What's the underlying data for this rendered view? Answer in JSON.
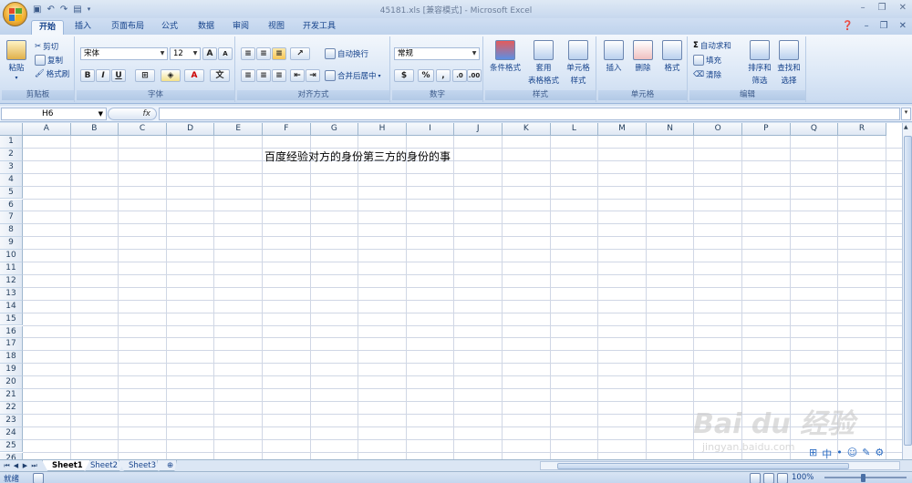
{
  "window": {
    "title": "45181.xls [兼容模式] - Microsoft Excel"
  },
  "tabs": [
    "开始",
    "插入",
    "页面布局",
    "公式",
    "数据",
    "审阅",
    "视图",
    "开发工具"
  ],
  "ribbon": {
    "clipboard": {
      "paste": "粘贴",
      "cut": "剪切",
      "copy": "复制",
      "format_painter": "格式刷",
      "label": "剪贴板"
    },
    "font": {
      "name": "宋体",
      "size": "12",
      "bold": "B",
      "italic": "I",
      "underline": "U",
      "label": "字体"
    },
    "alignment": {
      "wrap": "自动换行",
      "merge": "合并后居中",
      "label": "对齐方式"
    },
    "number": {
      "format": "常规",
      "percent": "%",
      "comma": ",",
      "label": "数字"
    },
    "styles": {
      "conditional": "条件格式",
      "table_format_1": "套用",
      "table_format_2": "表格格式",
      "cell_style_1": "单元格",
      "cell_style_2": "样式",
      "label": "样式"
    },
    "cells": {
      "insert": "插入",
      "delete": "删除",
      "format": "格式",
      "label": "单元格"
    },
    "editing": {
      "autosum": "自动求和",
      "fill": "填充",
      "clear": "清除",
      "sort_1": "排序和",
      "sort_2": "筛选",
      "find_1": "查找和",
      "find_2": "选择",
      "label": "编辑"
    }
  },
  "formula_bar": {
    "name_box": "H6",
    "fx": "fx",
    "value": ""
  },
  "sheet": {
    "columns": [
      "A",
      "B",
      "C",
      "D",
      "E",
      "F",
      "G",
      "H",
      "I",
      "J",
      "K",
      "L",
      "M",
      "N",
      "O",
      "P",
      "Q",
      "R"
    ],
    "rows": [
      "1",
      "2",
      "3",
      "4",
      "5",
      "6",
      "7",
      "8",
      "9",
      "10",
      "11",
      "12",
      "13",
      "14",
      "15",
      "16",
      "17",
      "18",
      "19",
      "20",
      "21",
      "22",
      "23",
      "24",
      "25",
      "26"
    ],
    "cell_text": "百度经验对方的身份第三方的身份的事"
  },
  "sheet_tabs": [
    "Sheet1",
    "Sheet2",
    "Sheet3"
  ],
  "status": {
    "mode": "就绪",
    "zoom": "100%"
  },
  "watermark": {
    "main": "Bai du 经验",
    "sub": "jingyan.baidu.com"
  }
}
